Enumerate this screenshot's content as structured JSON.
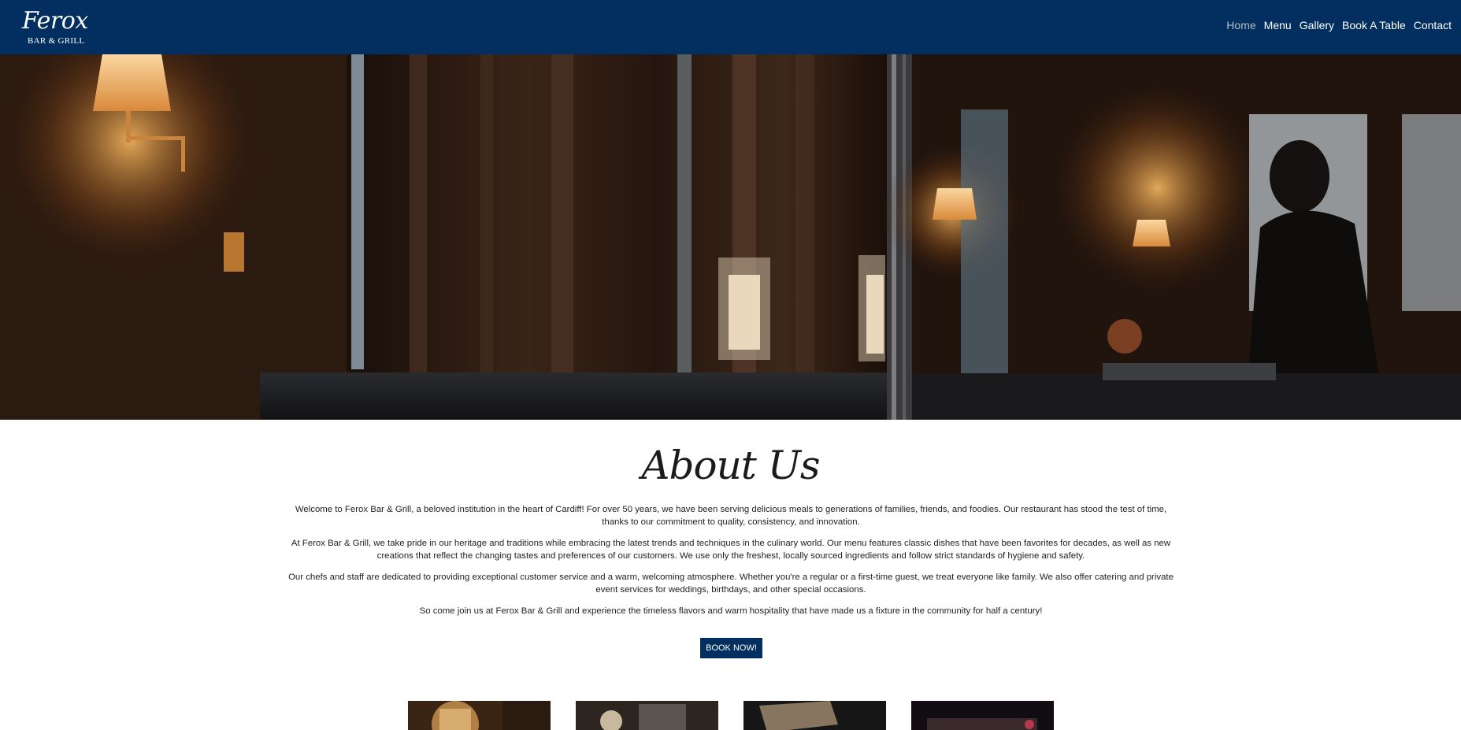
{
  "brand": {
    "name": "Ferox",
    "tagline": "BAR & GRILL"
  },
  "nav": {
    "items": [
      {
        "label": "Home",
        "active": true
      },
      {
        "label": "Menu",
        "active": false
      },
      {
        "label": "Gallery",
        "active": false
      },
      {
        "label": "Book A Table",
        "active": false
      },
      {
        "label": "Contact",
        "active": false
      }
    ]
  },
  "hero": {
    "alt": "Dimly lit restaurant interior with lamps and a guest at the bar"
  },
  "about": {
    "title": "About Us",
    "paragraphs": [
      "Welcome to Ferox Bar & Grill, a beloved institution in the heart of Cardiff! For over 50 years, we have been serving delicious meals to generations of families, friends, and foodies. Our restaurant has stood the test of time, thanks to our commitment to quality, consistency, and innovation.",
      "At Ferox Bar & Grill, we take pride in our heritage and traditions while embracing the latest trends and techniques in the culinary world. Our menu features classic dishes that have been favorites for decades, as well as new creations that reflect the changing tastes and preferences of our customers. We use only the freshest, locally sourced ingredients and follow strict standards of hygiene and safety.",
      "Our chefs and staff are dedicated to providing exceptional customer service and a warm, welcoming atmosphere. Whether you're a regular or a first-time guest, we treat everyone like family. We also offer catering and private event services for weddings, birthdays, and other special occasions.",
      "So come join us at Ferox Bar & Grill and experience the timeless flavors and warm hospitality that have made us a fixture in the community for half a century!"
    ],
    "cta": "BOOK NOW!"
  },
  "colors": {
    "navy": "#022f5f",
    "nav_active": "#b6bcc6",
    "text": "#222222"
  }
}
